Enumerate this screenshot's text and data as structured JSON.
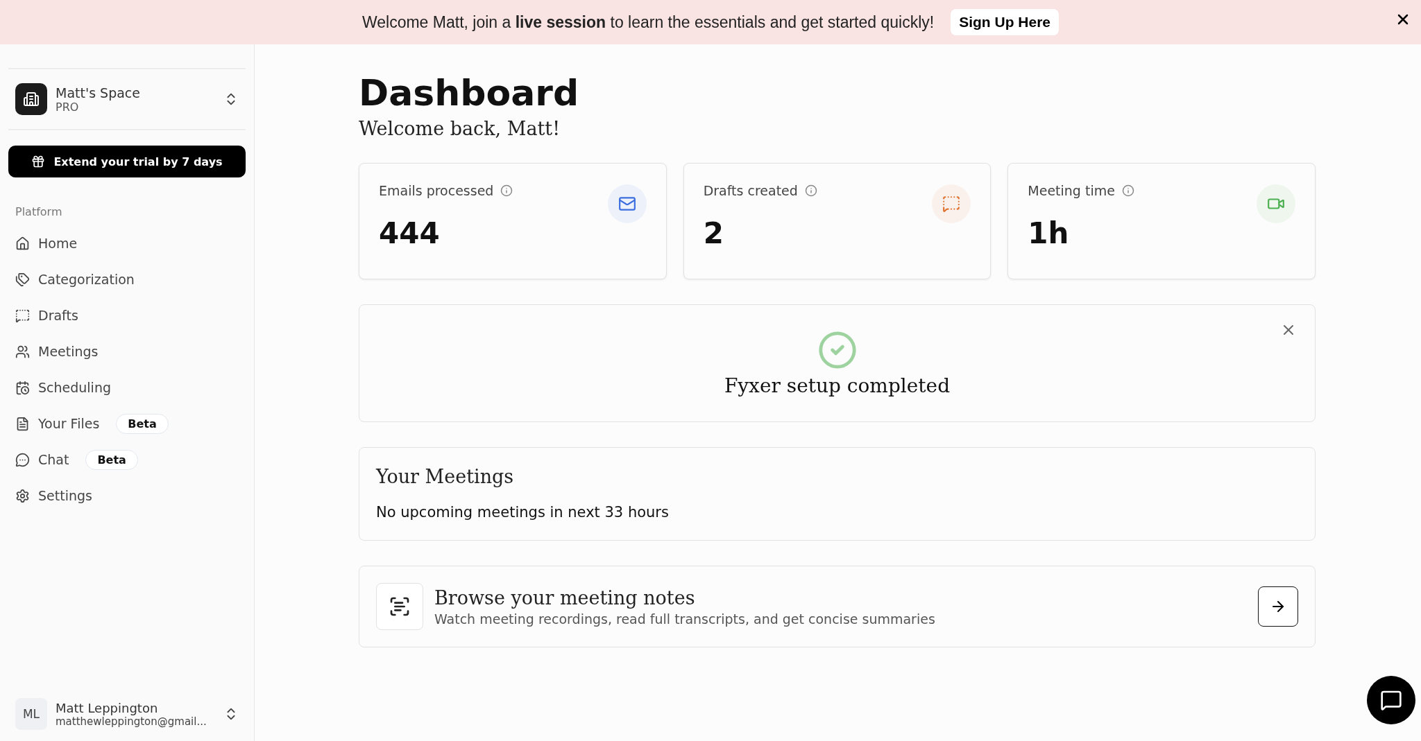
{
  "banner": {
    "text": "Welcome Matt, join a **live session** to learn the essentials and get started quickly!",
    "button": "Sign Up Here"
  },
  "sidebar": {
    "workspace": {
      "name": "Matt's Space",
      "plan": "PRO"
    },
    "trial_button": "Extend your trial by 7 days",
    "section": "Platform",
    "items": [
      {
        "label": "Home"
      },
      {
        "label": "Categorization"
      },
      {
        "label": "Drafts"
      },
      {
        "label": "Meetings"
      },
      {
        "label": "Scheduling"
      },
      {
        "label": "Your Files",
        "badge": "Beta"
      },
      {
        "label": "Chat",
        "badge": "Beta"
      },
      {
        "label": "Settings"
      }
    ],
    "user": {
      "initials": "ML",
      "name": "Matt Leppington",
      "email": "matthewleppington@gmail..."
    }
  },
  "page": {
    "title": "Dashboard",
    "subtitle": "Welcome back, Matt!"
  },
  "stats": [
    {
      "label": "Emails processed",
      "value": "444",
      "color": "#3b6fe0"
    },
    {
      "label": "Drafts created",
      "value": "2",
      "color": "#e0732f"
    },
    {
      "label": "Meeting time",
      "value": "1h",
      "color": "#4caf50"
    }
  ],
  "setup": {
    "text": "Fyxer setup completed"
  },
  "meetings": {
    "title": "Your Meetings",
    "empty": "No upcoming meetings in next 33 hours"
  },
  "notes": {
    "title": "Browse your meeting notes",
    "description": "Watch meeting recordings, read full transcripts, and get concise summaries"
  }
}
